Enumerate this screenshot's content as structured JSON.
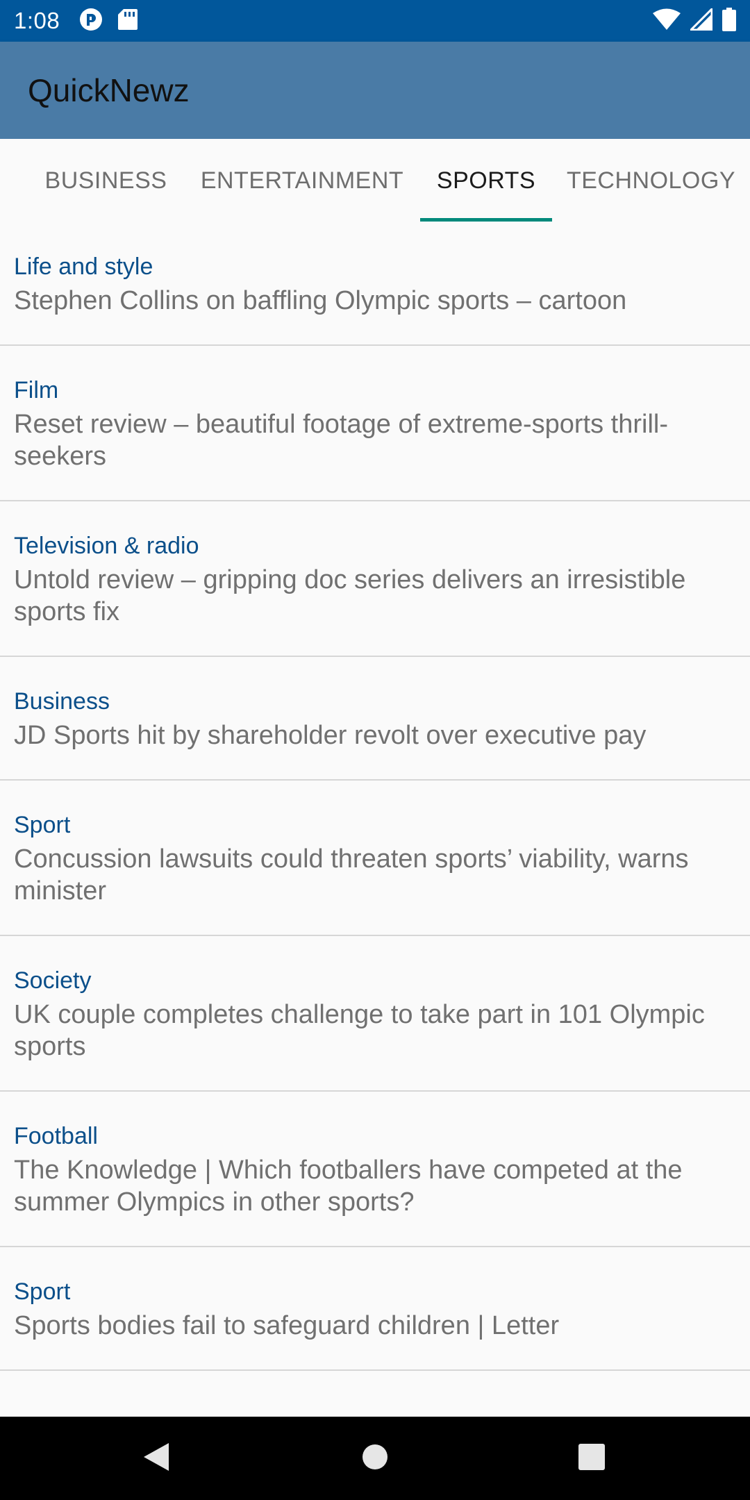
{
  "status_bar": {
    "time": "1:08",
    "left_icons": [
      "app-notification-icon",
      "sd-card-icon"
    ],
    "right_icons": [
      "wifi-icon",
      "cell-signal-icon",
      "battery-icon"
    ]
  },
  "app_bar": {
    "title": "QuickNewz"
  },
  "tabs": [
    {
      "label": "BUSINESS",
      "active": false
    },
    {
      "label": "ENTERTAINMENT",
      "active": false
    },
    {
      "label": "SPORTS",
      "active": true
    },
    {
      "label": "TECHNOLOGY",
      "active": false
    }
  ],
  "articles": [
    {
      "category": "Life and style",
      "title": "Stephen Collins on baffling Olympic sports – cartoon"
    },
    {
      "category": "Film",
      "title": "Reset review – beautiful footage of extreme-sports thrill-seekers"
    },
    {
      "category": "Television & radio",
      "title": "Untold review – gripping doc series delivers an irresistible sports fix"
    },
    {
      "category": "Business",
      "title": "JD Sports hit by shareholder revolt over executive pay"
    },
    {
      "category": "Sport",
      "title": "Concussion lawsuits could threaten sports’ viability, warns minister"
    },
    {
      "category": "Society",
      "title": "UK couple completes challenge to take part in 101 Olympic sports"
    },
    {
      "category": "Football",
      "title": "The Knowledge | Which footballers have competed at the summer Olympics in other sports?"
    },
    {
      "category": "Sport",
      "title": "Sports bodies fail to safeguard children | Letter"
    }
  ],
  "nav_bar": {
    "buttons": [
      "back-icon",
      "home-icon",
      "recents-icon"
    ]
  },
  "colors": {
    "status_bar": "#01579b",
    "app_bar": "#4a7ba6",
    "tab_indicator": "#00897b",
    "category_text": "#0b4f8a",
    "title_text": "#707070"
  }
}
